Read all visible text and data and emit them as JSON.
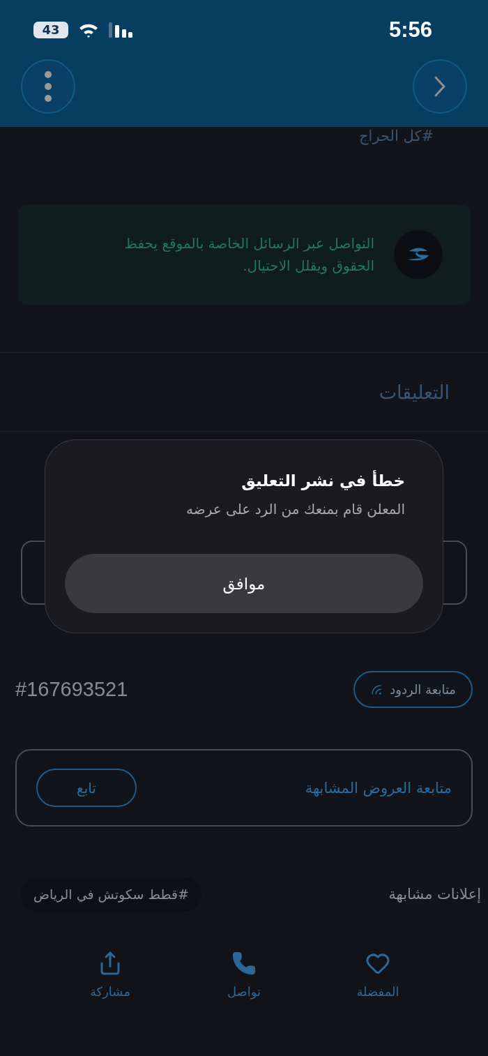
{
  "status_bar": {
    "battery": "43",
    "time": "5:56"
  },
  "category_tag": "#كل الحراج",
  "notice": {
    "text": "التواصل عبر الرسائل الخاصة بالموقع يحفظ الحقوق ويقلل الاحتيال."
  },
  "comments": {
    "title": "التعليقات"
  },
  "alert": {
    "title": "خطأ في نشر التعليق",
    "message": "المعلن قام بمنعك من الرد على عرضه",
    "button": "موافق"
  },
  "ad_number": "#167693521",
  "follow_replies_button": "متابعة الردود",
  "similar_offers": {
    "label": "متابعة العروض المشابهة",
    "button": "تابع"
  },
  "similar_ads": {
    "title": "إعلانات مشابهة",
    "tags": [
      "#قطط سكوتش في الرياض"
    ]
  },
  "bottom_nav": [
    {
      "kind": "favorite",
      "label": "المفضلة"
    },
    {
      "kind": "contact",
      "label": "تواصل"
    },
    {
      "kind": "share",
      "label": "مشاركة"
    }
  ]
}
